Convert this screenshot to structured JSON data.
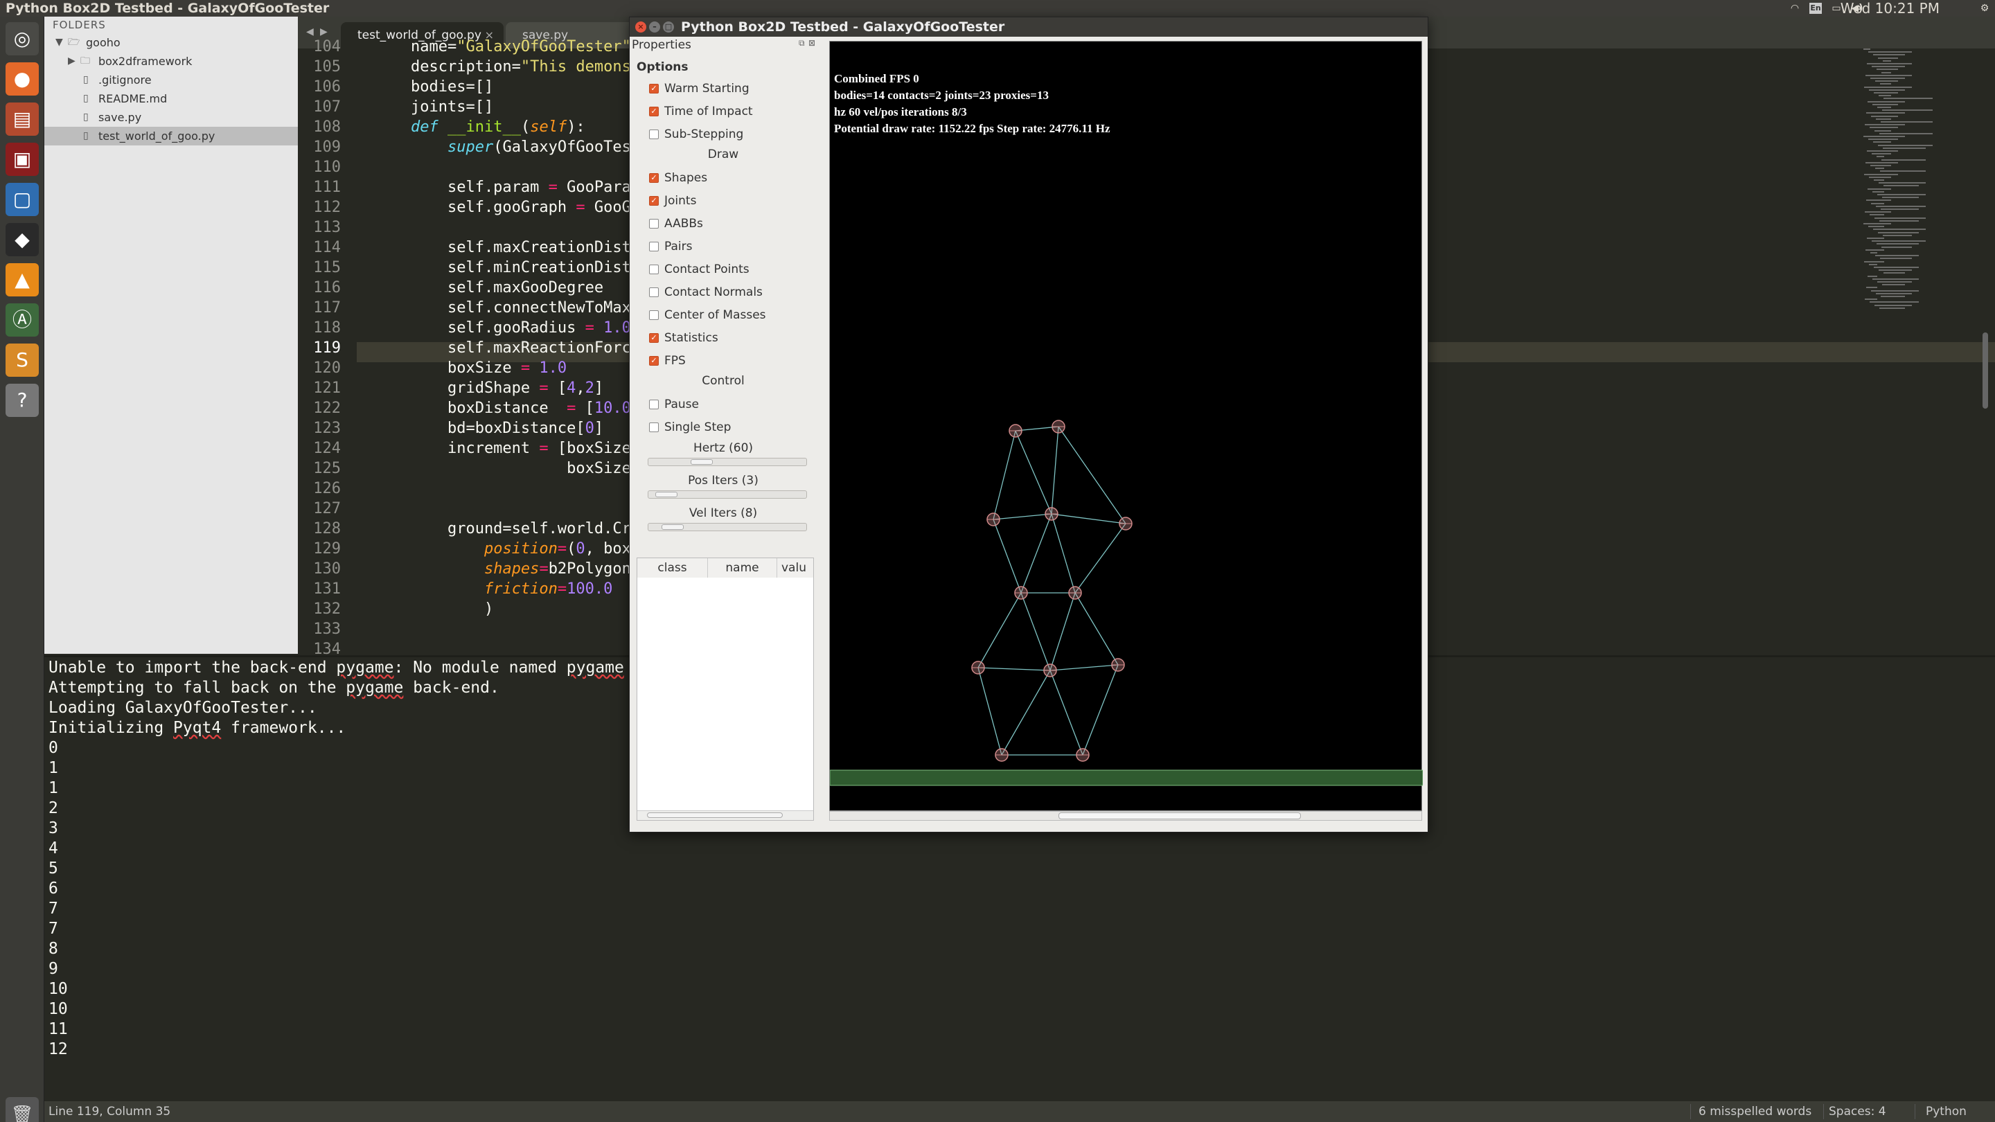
{
  "topbar": {
    "title": "Python Box2D Testbed - GalaxyOfGooTester",
    "clock": "Wed 10:21 PM",
    "icons": [
      "wifi-icon",
      "keyboard-icon",
      "battery-icon",
      "volume-icon",
      "power-icon"
    ]
  },
  "launcher": {
    "icons": [
      "ubuntu-dash-icon",
      "firefox-icon",
      "files-icon",
      "terminal-icon",
      "virtualbox-icon",
      "inkscape-icon",
      "vlc-icon",
      "software-updater-icon",
      "sublime-text-icon",
      "help-icon",
      "trash-icon"
    ]
  },
  "sidebar": {
    "header": "FOLDERS",
    "items": [
      {
        "label": "gooho",
        "kind": "folder-open"
      },
      {
        "label": "box2dframework",
        "kind": "folder"
      },
      {
        "label": ".gitignore",
        "kind": "file"
      },
      {
        "label": "README.md",
        "kind": "file"
      },
      {
        "label": "save.py",
        "kind": "file"
      },
      {
        "label": "test_world_of_goo.py",
        "kind": "file",
        "selected": true
      }
    ]
  },
  "tabs": [
    {
      "label": "test_world_of_goo.py",
      "active": true,
      "close": "×"
    },
    {
      "label": "save.py",
      "active": false
    }
  ],
  "editor": {
    "lines": [
      {
        "n": "104",
        "code": "    name=\"GalaxyOfGooTester\""
      },
      {
        "n": "105",
        "code": "    description=\"This demons"
      },
      {
        "n": "106",
        "code": "    bodies=[]"
      },
      {
        "n": "107",
        "code": "    joints=[]"
      },
      {
        "n": "108",
        "code": "    def __init__(self):"
      },
      {
        "n": "109",
        "code": "        super(GalaxyOfGooTes"
      },
      {
        "n": "110",
        "code": ""
      },
      {
        "n": "111",
        "code": "        self.param = GooPara"
      },
      {
        "n": "112",
        "code": "        self.gooGraph = GooG"
      },
      {
        "n": "113",
        "code": ""
      },
      {
        "n": "114",
        "code": "        self.maxCreationDist"
      },
      {
        "n": "115",
        "code": "        self.minCreationDist"
      },
      {
        "n": "116",
        "code": "        self.maxGooDegree"
      },
      {
        "n": "117",
        "code": "        self.connectNewToMax"
      },
      {
        "n": "118",
        "code": "        self.gooRadius = 1.0"
      },
      {
        "n": "119",
        "code": "        self.maxReactionForc"
      },
      {
        "n": "120",
        "code": "        boxSize = 1.0"
      },
      {
        "n": "121",
        "code": "        gridShape = [4,2]"
      },
      {
        "n": "122",
        "code": "        boxDistance  = [10.0"
      },
      {
        "n": "123",
        "code": "        bd=boxDistance[0]"
      },
      {
        "n": "124",
        "code": "        increment = [boxSize"
      },
      {
        "n": "125",
        "code": "                     boxSize"
      },
      {
        "n": "126",
        "code": ""
      },
      {
        "n": "127",
        "code": ""
      },
      {
        "n": "128",
        "code": "        ground=self.world.Cr"
      },
      {
        "n": "129",
        "code": "            position=(0, box"
      },
      {
        "n": "130",
        "code": "            shapes=b2Polygon"
      },
      {
        "n": "131",
        "code": "            friction=100.0"
      },
      {
        "n": "132",
        "code": "            )"
      },
      {
        "n": "133",
        "code": ""
      },
      {
        "n": "134",
        "code": ""
      }
    ],
    "current_line": "119"
  },
  "console": {
    "lines": [
      "Unable to import the back-end pygame: No module named pygame",
      "Attempting to fall back on the pygame back-end.",
      "Loading GalaxyOfGooTester...",
      "Initializing Pyqt4 framework...",
      "0",
      "1",
      "1",
      "2",
      "3",
      "4",
      "5",
      "6",
      "7",
      "7",
      "8",
      "9",
      "10",
      "10",
      "11",
      "12"
    ]
  },
  "status": {
    "position": "Line 119, Column 35",
    "spell": "6 misspelled words",
    "spaces": "Spaces: 4",
    "syntax": "Python"
  },
  "testbed": {
    "title": "Python Box2D Testbed - GalaxyOfGooTester",
    "properties_label": "Properties",
    "options_label": "Options",
    "options": [
      {
        "label": "Warm Starting",
        "checked": true
      },
      {
        "label": "Time of Impact",
        "checked": true
      },
      {
        "label": "Sub-Stepping",
        "checked": false
      }
    ],
    "draw_label": "Draw",
    "draw": [
      {
        "label": "Shapes",
        "checked": true
      },
      {
        "label": "Joints",
        "checked": true
      },
      {
        "label": "AABBs",
        "checked": false
      },
      {
        "label": "Pairs",
        "checked": false
      },
      {
        "label": "Contact Points",
        "checked": false
      },
      {
        "label": "Contact Normals",
        "checked": false
      },
      {
        "label": "Center of Masses",
        "checked": false
      },
      {
        "label": "Statistics",
        "checked": true
      },
      {
        "label": "FPS",
        "checked": true
      }
    ],
    "control_label": "Control",
    "control": [
      {
        "label": "Pause",
        "checked": false
      },
      {
        "label": "Single Step",
        "checked": false
      }
    ],
    "sliders": [
      {
        "label": "Hertz (60)",
        "value": 60
      },
      {
        "label": "Pos Iters (3)",
        "value": 3
      },
      {
        "label": "Vel Iters (8)",
        "value": 8
      }
    ],
    "table_headers": [
      "class",
      "name",
      "valu"
    ],
    "stats": [
      "Combined FPS 0",
      "bodies=14 contacts=2 joints=23 proxies=13",
      "hz 60 vel/pos iterations 8/3",
      "Potential draw rate: 1152.22 fps Step rate: 24776.11 Hz"
    ],
    "colors": {
      "node": "#d08a8a",
      "joint": "#7fc4c4",
      "ground_fill": "#2f5a2f",
      "ground_edge": "#7fbf7f"
    }
  }
}
